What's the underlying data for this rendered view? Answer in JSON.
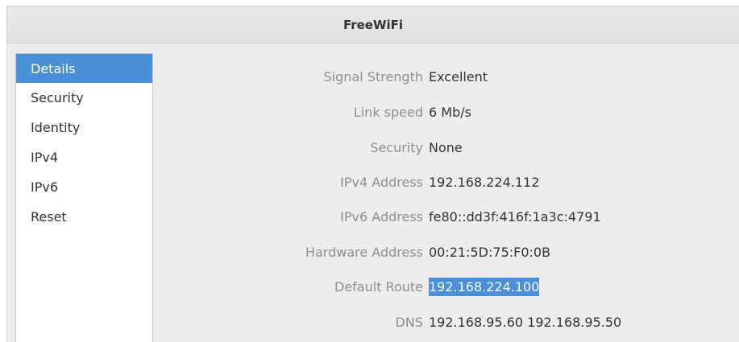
{
  "window": {
    "title": "FreeWiFi"
  },
  "sidebar": {
    "items": [
      {
        "label": "Details",
        "active": true
      },
      {
        "label": "Security",
        "active": false
      },
      {
        "label": "Identity",
        "active": false
      },
      {
        "label": "IPv4",
        "active": false
      },
      {
        "label": "IPv6",
        "active": false
      },
      {
        "label": "Reset",
        "active": false
      }
    ]
  },
  "details": {
    "rows": [
      {
        "label": "Signal Strength",
        "value": "Excellent"
      },
      {
        "label": "Link speed",
        "value": "6 Mb/s"
      },
      {
        "label": "Security",
        "value": "None"
      },
      {
        "label": "IPv4 Address",
        "value": "192.168.224.112"
      },
      {
        "label": "IPv6 Address",
        "value": "fe80::dd3f:416f:1a3c:4791"
      },
      {
        "label": "Hardware Address",
        "value": "00:21:5D:75:F0:0B"
      },
      {
        "label": "Default Route",
        "value": "192.168.224.100",
        "selected": true
      },
      {
        "label": "DNS",
        "value": "192.168.95.60 192.168.95.50"
      }
    ]
  },
  "colors": {
    "accent": "#4a90d9",
    "label_text": "#8b8e8f",
    "value_text": "#2e3436"
  }
}
